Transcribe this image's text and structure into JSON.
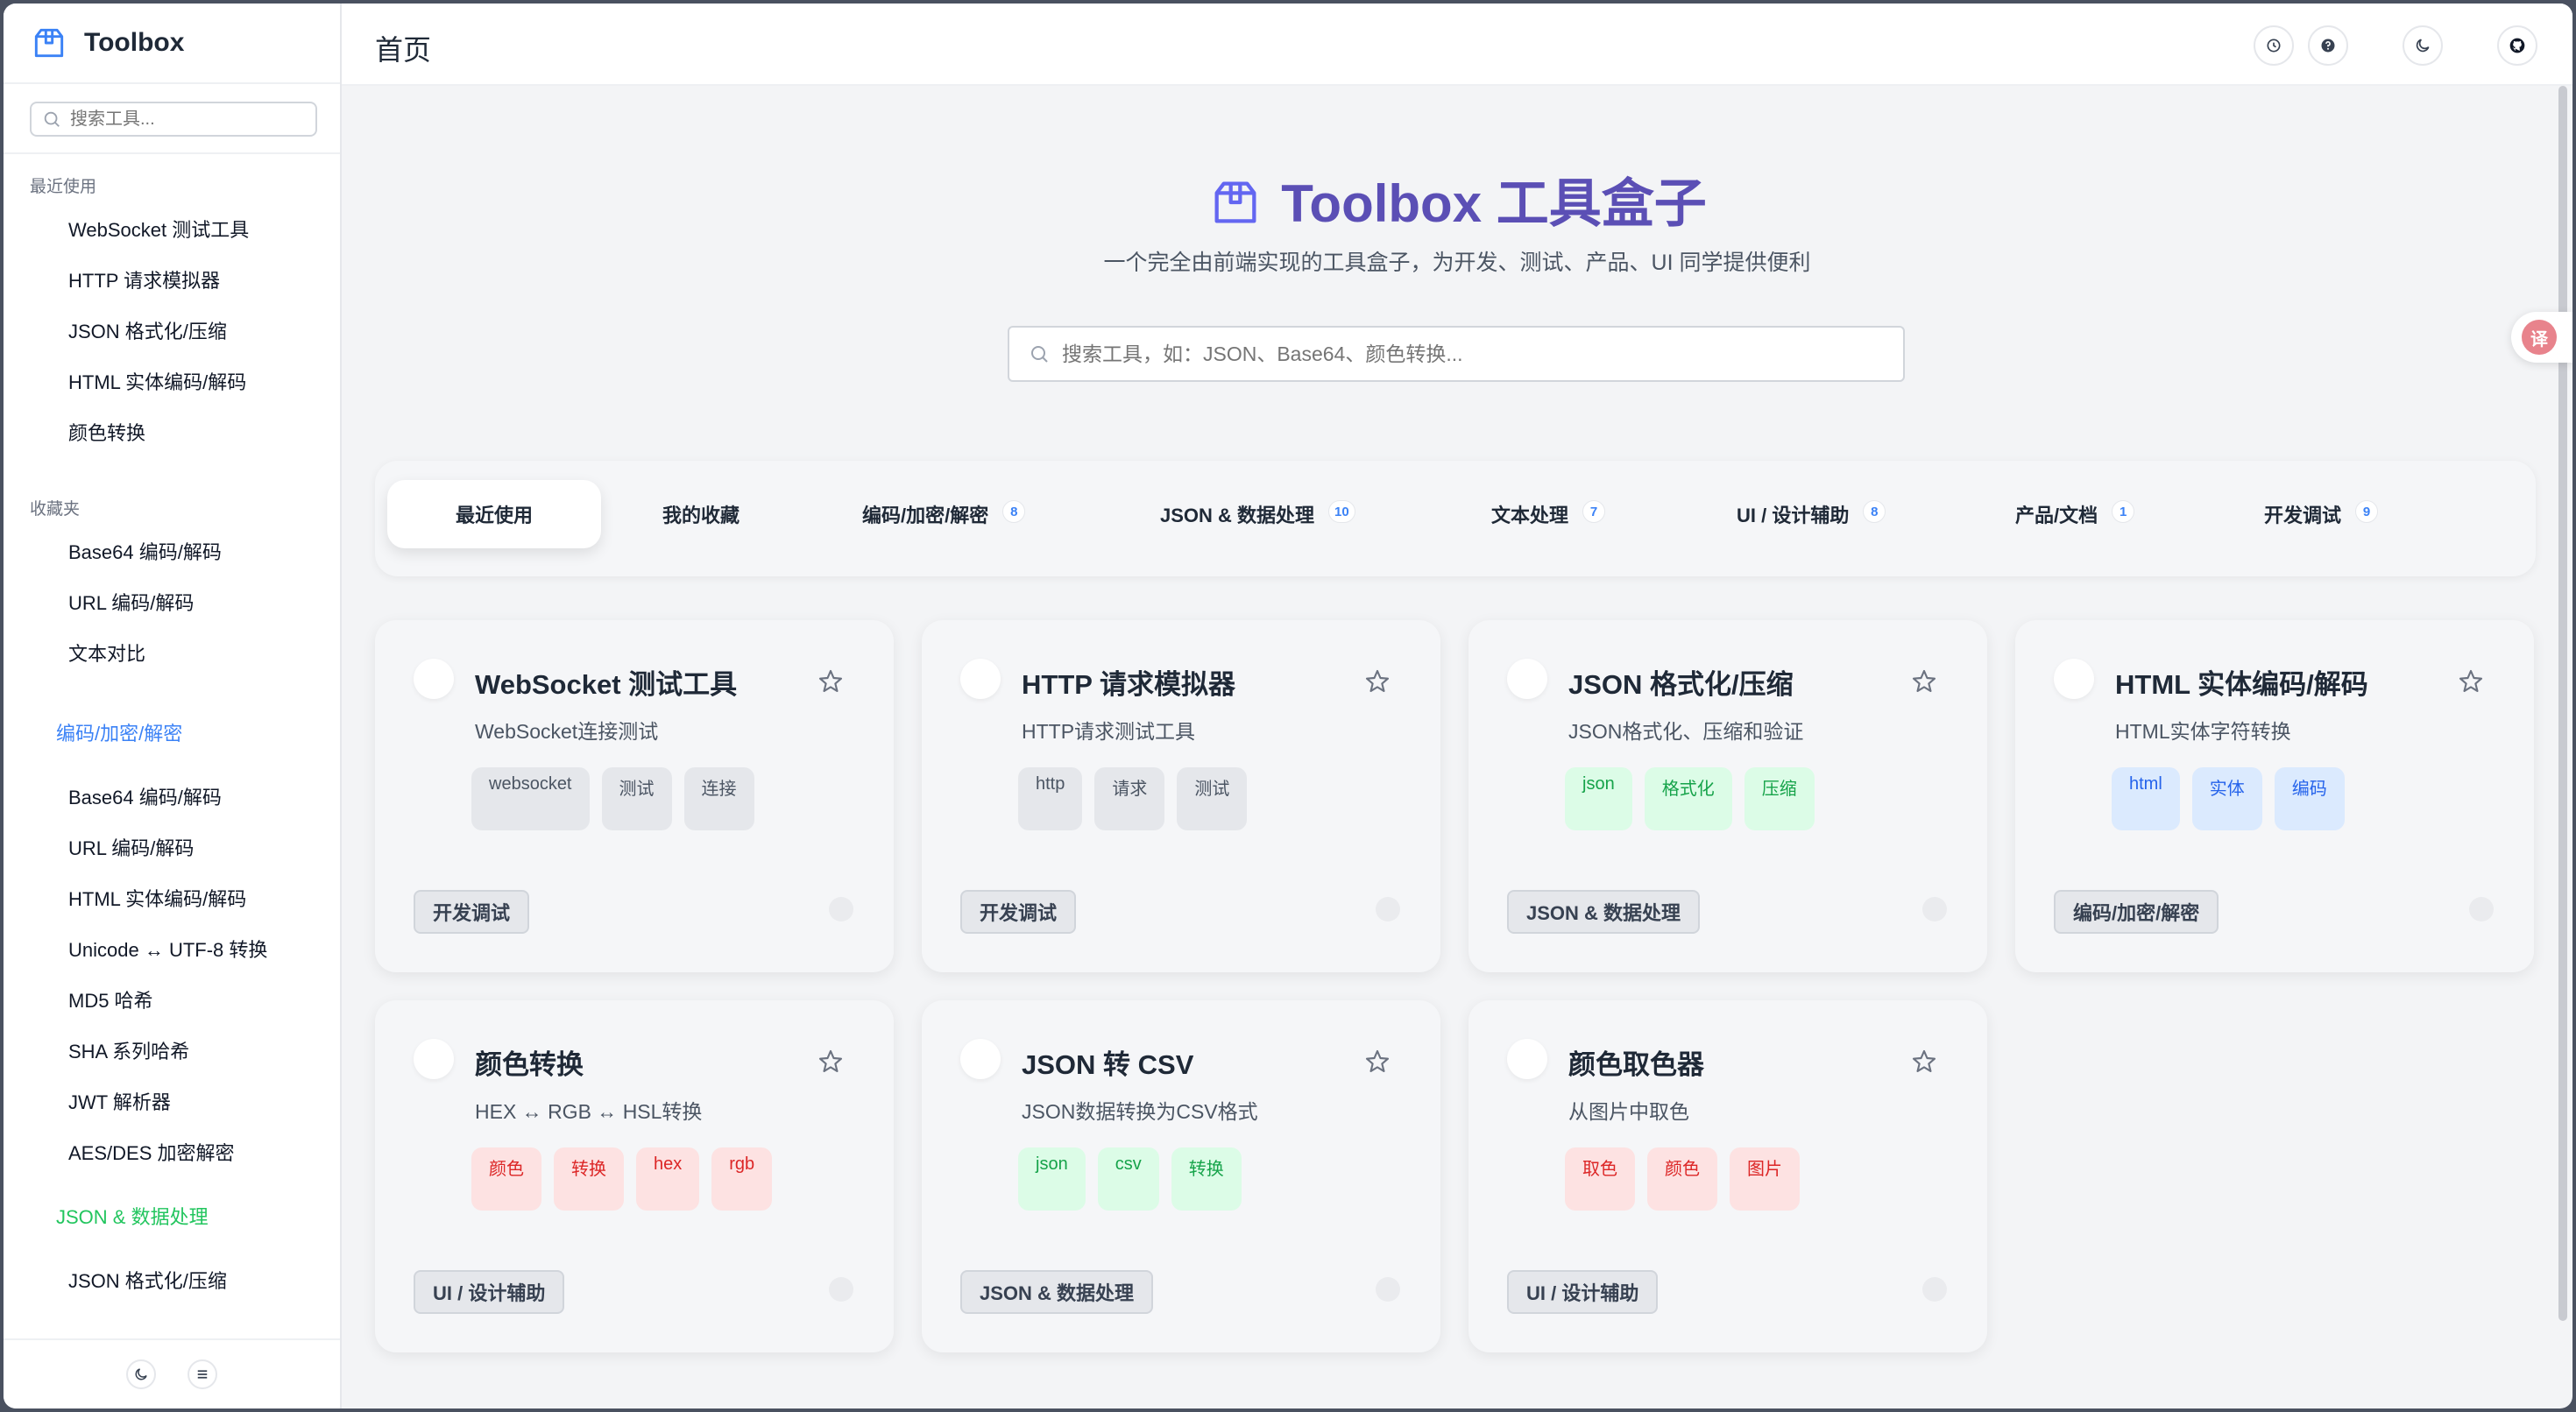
{
  "app": {
    "name": "Toolbox"
  },
  "sidebar": {
    "search_placeholder": "搜索工具...",
    "recent_title": "最近使用",
    "recent": [
      "WebSocket 测试工具",
      "HTTP 请求模拟器",
      "JSON 格式化/压缩",
      "HTML 实体编码/解码",
      "颜色转换"
    ],
    "favorites_title": "收藏夹",
    "favorites": [
      "Base64 编码/解码",
      "URL 编码/解码",
      "文本对比"
    ],
    "categories": [
      {
        "name": "编码/加密/解密",
        "color": "#3b82f6",
        "items": [
          "Base64 编码/解码",
          "URL 编码/解码",
          "HTML 实体编码/解码",
          "Unicode ↔ UTF-8 转换",
          "MD5 哈希",
          "SHA 系列哈希",
          "JWT 解析器",
          "AES/DES 加密解密"
        ]
      },
      {
        "name": "JSON & 数据处理",
        "color": "#22c55e",
        "items": [
          "JSON 格式化/压缩"
        ]
      }
    ]
  },
  "header": {
    "title": "首页"
  },
  "hero": {
    "title": "Toolbox 工具盒子",
    "subtitle": "一个完全由前端实现的工具盒子，为开发、测试、产品、UI 同学提供便利",
    "search_placeholder": "搜索工具，如：JSON、Base64、颜色转换..."
  },
  "tabs": [
    {
      "label": "最近使用",
      "count": null
    },
    {
      "label": "我的收藏",
      "count": null
    },
    {
      "label": "编码/加密/解密",
      "count": "8"
    },
    {
      "label": "JSON & 数据处理",
      "count": "10"
    },
    {
      "label": "文本处理",
      "count": "7"
    },
    {
      "label": "UI / 设计辅助",
      "count": "8"
    },
    {
      "label": "产品/文档",
      "count": "1"
    },
    {
      "label": "开发调试",
      "count": "9"
    }
  ],
  "cards": [
    {
      "title": "WebSocket 测试工具",
      "desc": "WebSocket连接测试",
      "tags": [
        "websocket",
        "测试",
        "连接"
      ],
      "tag_color": "gray",
      "category": "开发调试"
    },
    {
      "title": "HTTP 请求模拟器",
      "desc": "HTTP请求测试工具",
      "tags": [
        "http",
        "请求",
        "测试"
      ],
      "tag_color": "gray",
      "category": "开发调试"
    },
    {
      "title": "JSON 格式化/压缩",
      "desc": "JSON格式化、压缩和验证",
      "tags": [
        "json",
        "格式化",
        "压缩"
      ],
      "tag_color": "green",
      "category": "JSON & 数据处理"
    },
    {
      "title": "HTML 实体编码/解码",
      "desc": "HTML实体字符转换",
      "tags": [
        "html",
        "实体",
        "编码"
      ],
      "tag_color": "blue",
      "category": "编码/加密/解密"
    },
    {
      "title": "颜色转换",
      "desc": "HEX ↔ RGB ↔ HSL转换",
      "tags": [
        "颜色",
        "转换",
        "hex",
        "rgb"
      ],
      "tag_color": "red",
      "category": "UI / 设计辅助"
    },
    {
      "title": "JSON 转 CSV",
      "desc": "JSON数据转换为CSV格式",
      "tags": [
        "json",
        "csv",
        "转换"
      ],
      "tag_color": "green",
      "category": "JSON & 数据处理"
    },
    {
      "title": "颜色取色器",
      "desc": "从图片中取色",
      "tags": [
        "取色",
        "颜色",
        "图片"
      ],
      "tag_color": "red",
      "category": "UI / 设计辅助"
    }
  ],
  "colors": {
    "accent": "#5b4fb5",
    "blue": "#3b82f6",
    "green": "#22c55e"
  },
  "icons": {
    "translate": "译"
  }
}
